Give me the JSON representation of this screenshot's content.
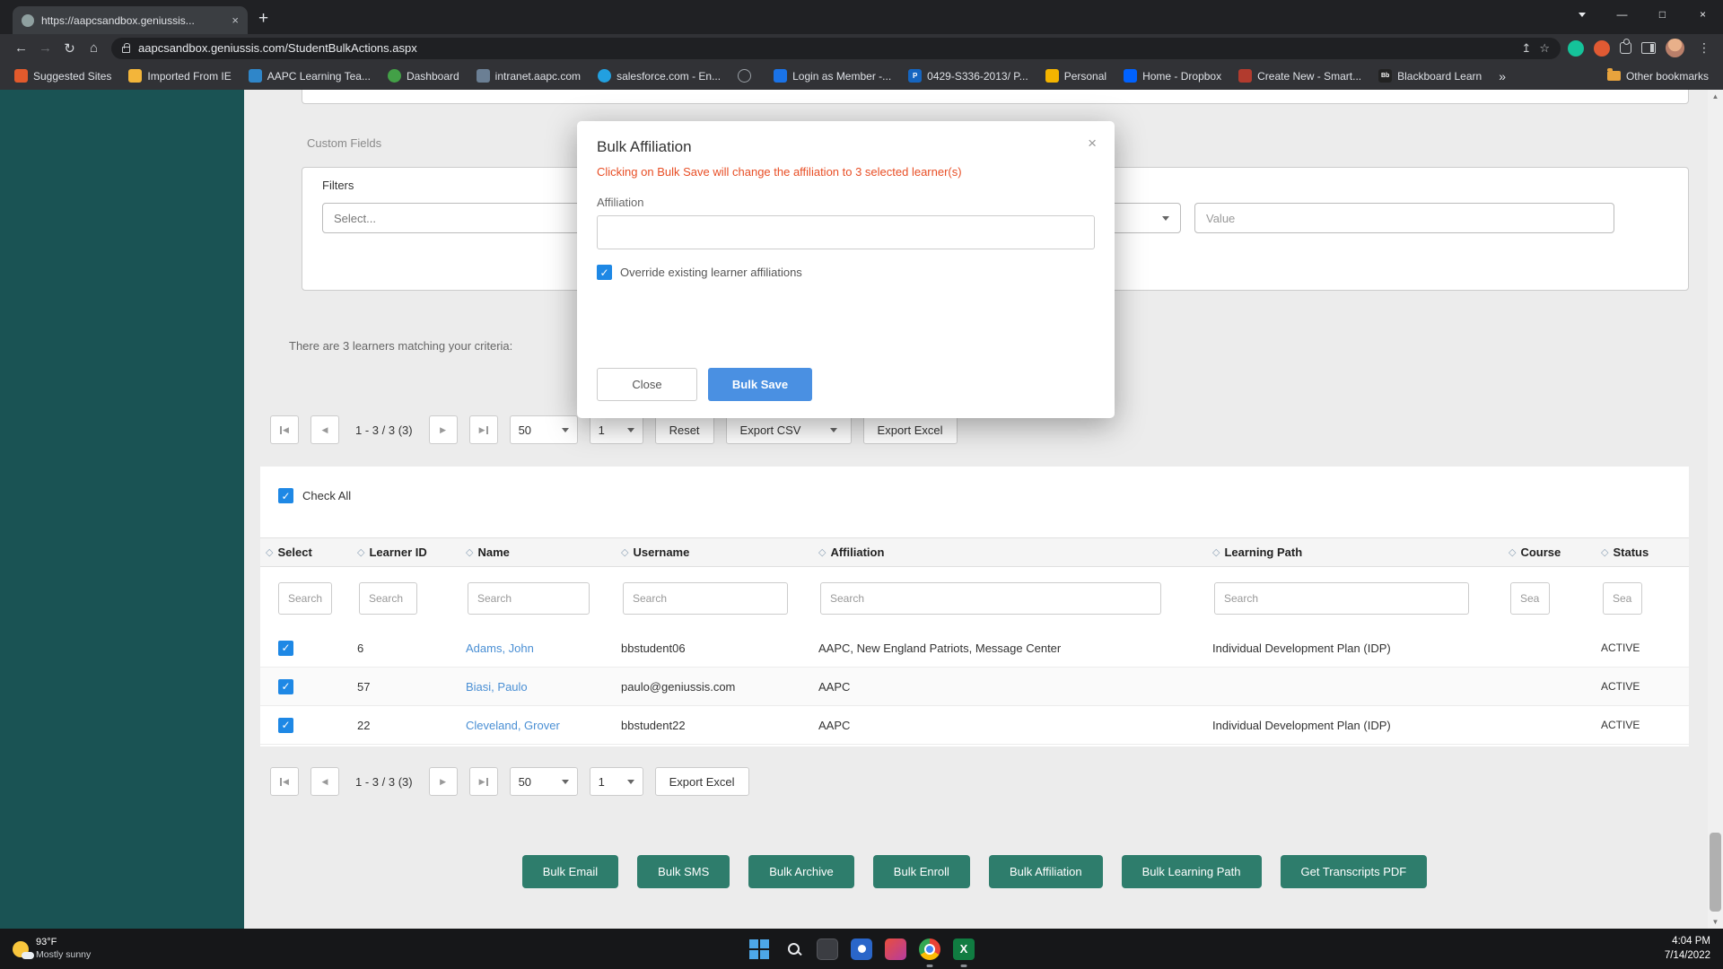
{
  "browser": {
    "tab_title": "https://aapcsandbox.geniussis...",
    "url": "aapcsandbox.geniussis.com/StudentBulkActions.aspx",
    "bookmarks": [
      {
        "label": "Suggested Sites",
        "letter": ""
      },
      {
        "label": "Imported From IE",
        "letter": ""
      },
      {
        "label": "AAPC Learning Tea...",
        "letter": ""
      },
      {
        "label": "Dashboard",
        "letter": ""
      },
      {
        "label": "intranet.aapc.com",
        "letter": ""
      },
      {
        "label": "salesforce.com - En...",
        "letter": ""
      },
      {
        "label": "",
        "letter": ""
      },
      {
        "label": "Login as Member -...",
        "letter": ""
      },
      {
        "label": "0429-S336-2013/ P...",
        "letter": "P"
      },
      {
        "label": "Personal",
        "letter": ""
      },
      {
        "label": "Home - Dropbox",
        "letter": ""
      },
      {
        "label": "Create New - Smart...",
        "letter": ""
      },
      {
        "label": "Blackboard Learn",
        "letter": "Bb"
      }
    ],
    "other_bookmarks": "Other bookmarks"
  },
  "page": {
    "custom_fields_label": "Custom Fields",
    "filters_label": "Filters",
    "filter_select_placeholder": "Select...",
    "value_placeholder": "Value",
    "results_text": "There are 3 learners matching your criteria:",
    "pagination": {
      "range_text": "1 - 3 / 3 (3)",
      "page_size": "50",
      "page_number": "1",
      "reset_label": "Reset",
      "export_csv_label": "Export CSV",
      "export_excel_label": "Export Excel"
    },
    "check_all_label": "Check All",
    "table": {
      "search_placeholder": "Search",
      "columns": [
        "Select",
        "Learner ID",
        "Name",
        "Username",
        "Affiliation",
        "Learning Path",
        "Course",
        "Status"
      ],
      "rows": [
        {
          "learner_id": "6",
          "name": "Adams, John",
          "username": "bbstudent06",
          "affiliation": "AAPC, New England Patriots, Message Center",
          "learning_path": "Individual Development Plan (IDP)",
          "course": "",
          "status": "ACTIVE"
        },
        {
          "learner_id": "57",
          "name": "Biasi, Paulo",
          "username": "paulo@geniussis.com",
          "affiliation": "AAPC",
          "learning_path": "",
          "course": "",
          "status": "ACTIVE"
        },
        {
          "learner_id": "22",
          "name": "Cleveland, Grover",
          "username": "bbstudent22",
          "affiliation": "AAPC",
          "learning_path": "Individual Development Plan (IDP)",
          "course": "",
          "status": "ACTIVE"
        }
      ]
    },
    "bulk_buttons": [
      "Bulk Email",
      "Bulk SMS",
      "Bulk Archive",
      "Bulk Enroll",
      "Bulk Affiliation",
      "Bulk Learning Path",
      "Get Transcripts PDF"
    ]
  },
  "modal": {
    "title": "Bulk Affiliation",
    "warning": "Clicking on Bulk Save will change the affiliation to 3 selected learner(s)",
    "affiliation_label": "Affiliation",
    "affiliation_value": "",
    "override_label": "Override existing learner affiliations",
    "close_label": "Close",
    "save_label": "Bulk Save"
  },
  "taskbar": {
    "weather_temp": "93°F",
    "weather_desc": "Mostly sunny",
    "time": "4:04 PM",
    "date": "7/14/2022"
  },
  "colors": {
    "sidebar_teal": "#1a5354",
    "accent_teal": "#2e7d6c",
    "save_blue": "#4a90e2",
    "checkbox_blue": "#1e88e5",
    "link_blue": "#4a8fd4",
    "warning_orange": "#e84e25"
  },
  "icons": {
    "back": "←",
    "forward": "→",
    "reload": "↻",
    "home": "⌂",
    "share": "↥",
    "star": "☆",
    "kebab": "⋮",
    "new_tab": "+",
    "close": "×",
    "minimize": "—",
    "maximize": "□",
    "overflow": "»",
    "sort": "◇",
    "prev": "◀",
    "next": "▶",
    "scroll_up": "▲",
    "scroll_down": "▼",
    "excel_letter": "X"
  }
}
